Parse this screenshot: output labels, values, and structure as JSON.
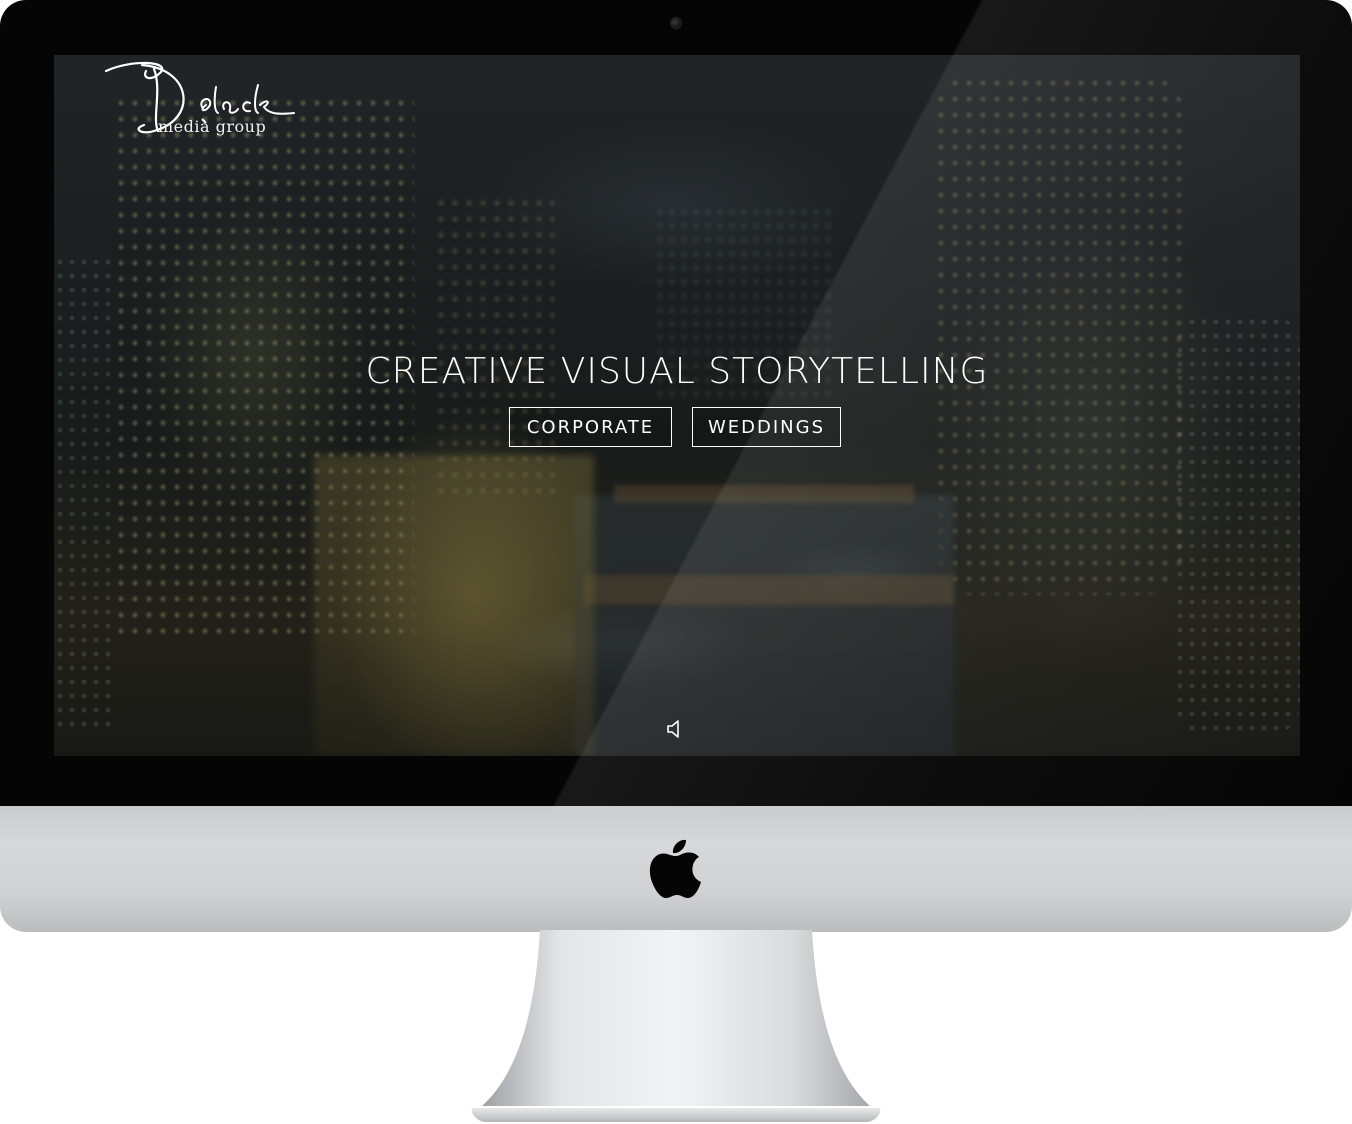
{
  "brand": {
    "script": "Delack",
    "subtitle": "media group"
  },
  "hero": {
    "headline": "CREATIVE VISUAL STORYTELLING",
    "buttons": [
      {
        "label": "CORPORATE"
      },
      {
        "label": "WEDDINGS"
      }
    ]
  },
  "icons": {
    "sound": "speaker-icon",
    "device_logo": "apple-logo"
  },
  "colors": {
    "text": "#ffffff",
    "bezel": "#050505",
    "chin": "#d0d2d4"
  }
}
